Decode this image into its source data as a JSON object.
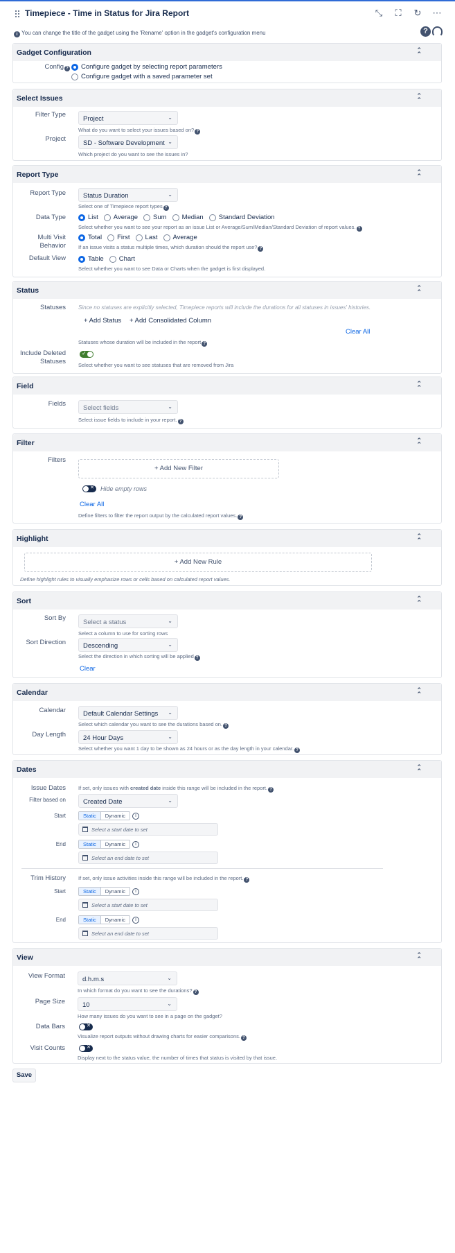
{
  "header": {
    "title": "Timepiece - Time in Status for Jira Report",
    "info": "You can change the title of the gadget using the 'Rename' option in the gadget's configuration menu"
  },
  "gadget_config": {
    "title": "Gadget Configuration",
    "config_label": "Config",
    "options": [
      "Configure gadget by selecting report parameters",
      "Configure gadget with a saved parameter set"
    ],
    "selected": 0
  },
  "select_issues": {
    "title": "Select Issues",
    "filter_type_label": "Filter Type",
    "filter_type_value": "Project",
    "filter_type_hint": "What do you want to select your issues based on?",
    "project_label": "Project",
    "project_value": "SD - Software Development",
    "project_hint": "Which project do you want to see the issues in?"
  },
  "report_type": {
    "title": "Report Type",
    "report_type_label": "Report Type",
    "report_type_value": "Status Duration",
    "report_type_hint": "Select one of Timepiece report types",
    "data_type_label": "Data Type",
    "data_type_options": [
      "List",
      "Average",
      "Sum",
      "Median",
      "Standard Deviation"
    ],
    "data_type_hint": "Select whether you want to see your report as an issue List or Average/Sum/Median/Standard Deviation of report values.",
    "multi_visit_label_1": "Multi Visit",
    "multi_visit_label_2": "Behavior",
    "multi_visit_options": [
      "Total",
      "First",
      "Last",
      "Average"
    ],
    "multi_visit_hint": "If an issue visits a status multiple times, which duration should the report use?",
    "default_view_label": "Default View",
    "default_view_options": [
      "Table",
      "Chart"
    ],
    "default_view_hint": "Select whether you want to see Data or Charts when the gadget is first displayed."
  },
  "status": {
    "title": "Status",
    "statuses_label": "Statuses",
    "statuses_placeholder": "Since no statuses are explicitly selected, Timepiece reports will include the durations for all statuses in issues' histories.",
    "add_status": "+ Add Status",
    "add_consolidated": "+ Add Consolidated Column",
    "clear_all": "Clear All",
    "statuses_hint": "Statuses whose duration will be included in the report",
    "include_deleted_label_1": "Include Deleted",
    "include_deleted_label_2": "Statuses",
    "include_deleted_hint": "Select whether you want to see statuses that are removed from Jira"
  },
  "field": {
    "title": "Field",
    "fields_label": "Fields",
    "fields_placeholder": "Select fields",
    "fields_hint": "Select issue fields to include in your report."
  },
  "filter": {
    "title": "Filter",
    "filters_label": "Filters",
    "add_new_filter": "+   Add New Filter",
    "hide_empty_rows": "Hide empty rows",
    "clear_all": "Clear All",
    "filters_hint": "Define filters to filter the report output by the calculated report values."
  },
  "highlight": {
    "title": "Highlight",
    "add_new_rule": "+   Add New Rule",
    "hint": "Define highlight rules to visually emphasize rows or cells based on calculated report values."
  },
  "sort": {
    "title": "Sort",
    "sort_by_label": "Sort By",
    "sort_by_placeholder": "Select a status",
    "sort_by_hint": "Select a column to use for sorting rows",
    "direction_label": "Sort Direction",
    "direction_value": "Descending",
    "direction_hint": "Select the direction in which sorting will be applied",
    "clear": "Clear"
  },
  "calendar": {
    "title": "Calendar",
    "calendar_label": "Calendar",
    "calendar_value": "Default Calendar Settings",
    "calendar_hint": "Select which calendar you want to see the durations based on.",
    "day_length_label": "Day Length",
    "day_length_value": "24 Hour Days",
    "day_length_hint": "Select whether you want 1 day to be shown as 24 hours or as the day length in your calendar."
  },
  "dates": {
    "title": "Dates",
    "issue_dates_label": "Issue Dates",
    "issue_dates_hint_pre": "If set, only issues with ",
    "issue_dates_hint_bold": "created date",
    "issue_dates_hint_post": " inside this range will be included in the report.",
    "filter_based_on_label": "Filter based on",
    "filter_based_on_value": "Created Date",
    "start_label": "Start",
    "end_label": "End",
    "static": "Static",
    "dynamic": "Dynamic",
    "start_placeholder": "Select a start date to set",
    "end_placeholder": "Select an end date to set",
    "trim_history_label": "Trim History",
    "trim_history_hint": "If set, only issue activities inside this range will be included in the report."
  },
  "view": {
    "title": "View",
    "view_format_label": "View Format",
    "view_format_value": "d.h.m.s",
    "view_format_hint": "In which format do you want to see the durations?",
    "page_size_label": "Page Size",
    "page_size_value": "10",
    "page_size_hint": "How many issues do you want to see in a page on the gadget?",
    "data_bars_label": "Data Bars",
    "data_bars_hint": "Visualize report outputs without drawing charts for easier comparisons.",
    "visit_counts_label": "Visit Counts",
    "visit_counts_hint": "Display next to the status value, the number of times that status is visited by that issue."
  },
  "save_label": "Save"
}
